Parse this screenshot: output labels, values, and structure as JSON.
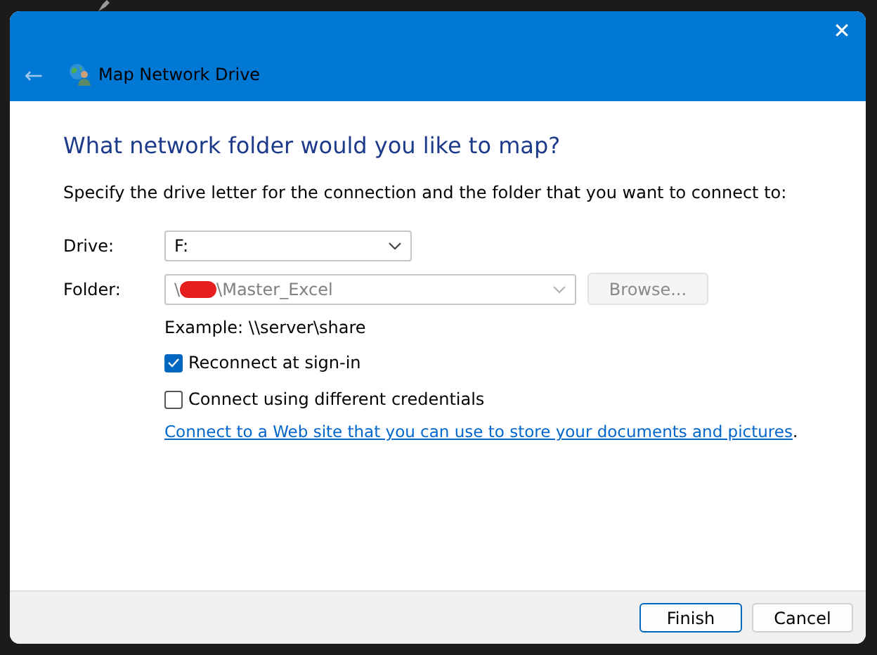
{
  "window": {
    "title": "Map Network Drive",
    "back": "←",
    "close": "✕"
  },
  "heading": "What network folder would you like to map?",
  "instruction": "Specify the drive letter for the connection and the folder that you want to connect to:",
  "fields": [
    {
      "label": "Drive:",
      "value": "F:",
      "disabled": false
    },
    {
      "label": "Folder:",
      "value_start": "\\",
      "redacted": true,
      "value_end": "\\Master_Excel",
      "disabled": true
    }
  ],
  "browse_button": {
    "label": "Browse...",
    "disabled": true
  },
  "example": "Example: \\\\server\\share",
  "checkboxes": [
    {
      "label": "Reconnect at sign-in",
      "checked": true
    },
    {
      "label": "Connect using different credentials",
      "checked": false
    }
  ],
  "link": {
    "text": "Connect to a Web site that you can use to store your documents and pictures",
    "trailing": "."
  },
  "buttons": [
    {
      "label": "Finish",
      "selected": true
    },
    {
      "label": "Cancel",
      "selected": false
    }
  ]
}
